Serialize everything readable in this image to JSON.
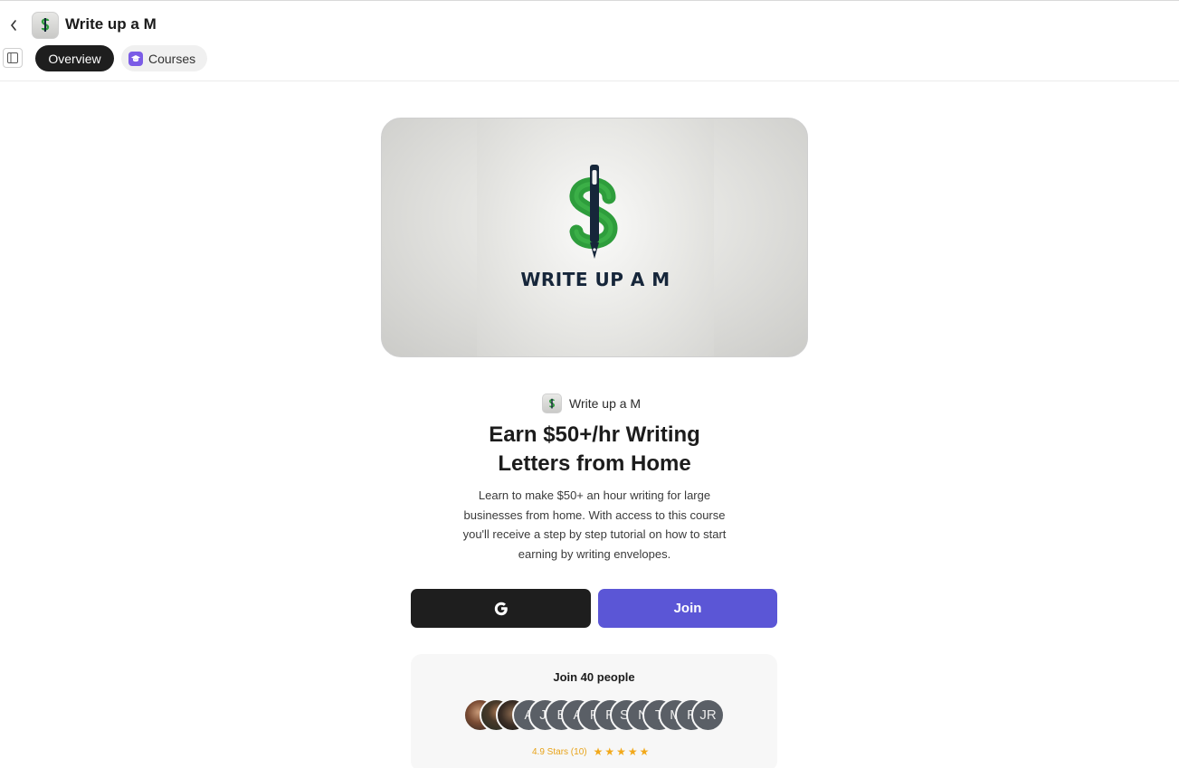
{
  "app": {
    "title": "Write up a M"
  },
  "tabs": [
    {
      "label": "Overview",
      "active": true
    },
    {
      "label": "Courses",
      "active": false,
      "icon": "graduation-cap-icon"
    }
  ],
  "hero": {
    "logo_text": "WRITE UP A M"
  },
  "brand": {
    "name": "Write up a M"
  },
  "headline": {
    "line1": "Earn $50+/hr Writing",
    "line2": "Letters from Home"
  },
  "description": [
    "Learn to make $50+ an hour writing for large",
    "businesses from home. With access to this course",
    "you'll receive a step by step tutorial on how to start",
    "earning by writing envelopes."
  ],
  "buttons": {
    "google_icon": "google-icon",
    "join_label": "Join"
  },
  "members": {
    "title": "Join 40 people",
    "avatars": [
      "",
      "",
      "",
      "A",
      "J(",
      "B",
      "A",
      "F",
      "R",
      "S(",
      "N",
      "T",
      "M",
      "R",
      "JR"
    ],
    "rating_text": "4.9 Stars (10)",
    "stars": 5
  },
  "colors": {
    "accent": "#5b56d6",
    "dark": "#1e1e1e",
    "star": "#f2a91b",
    "logo_green": "#2e9d3c",
    "logo_navy": "#16263a"
  }
}
